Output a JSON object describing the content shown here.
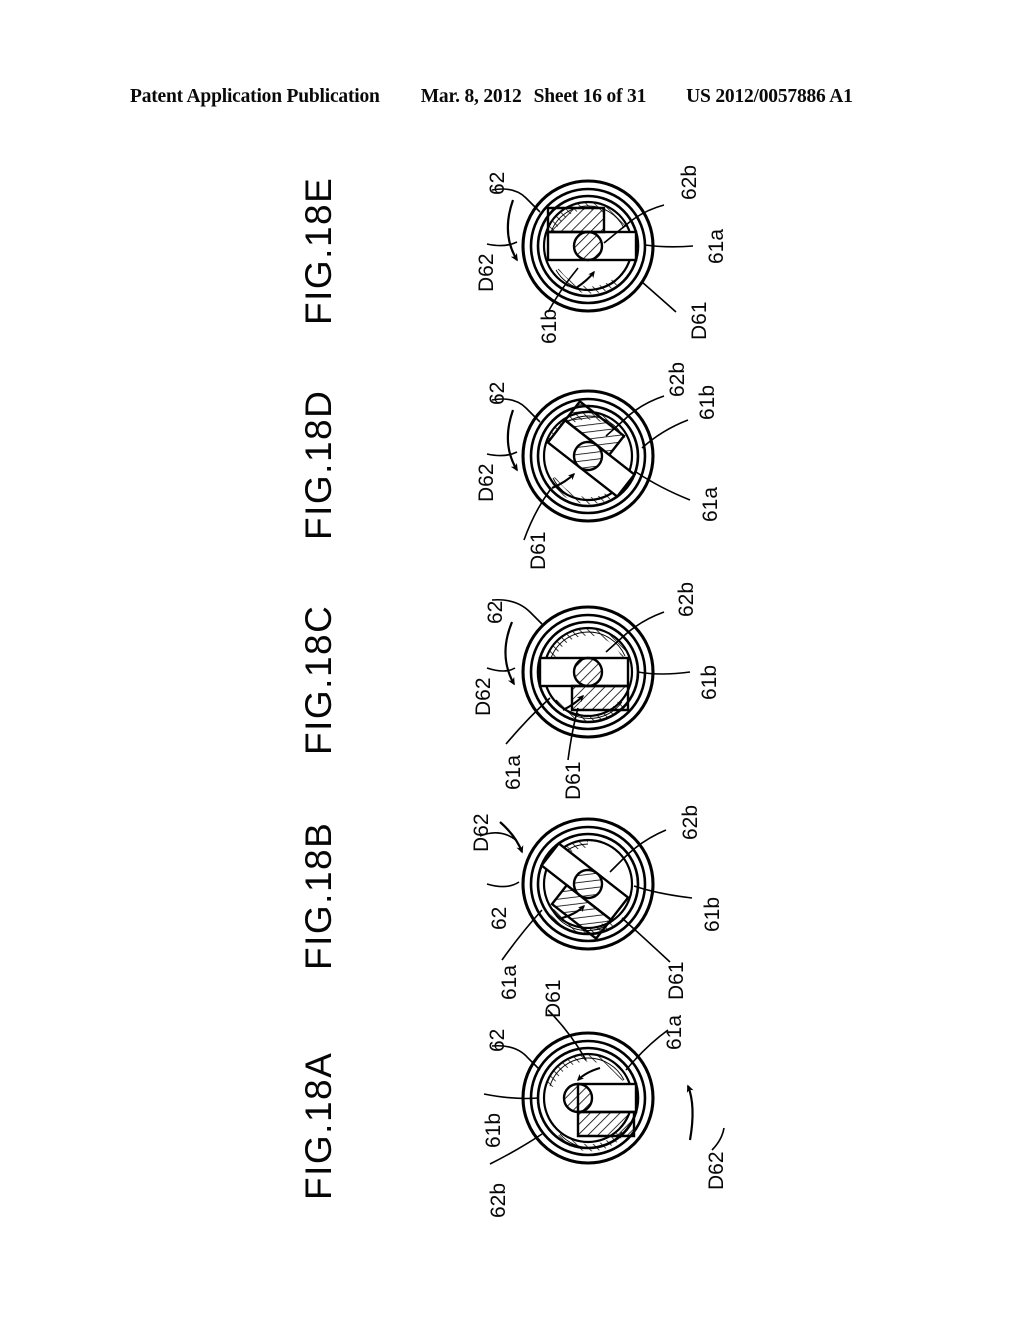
{
  "header": {
    "publication": "Patent Application Publication",
    "date": "Mar. 8, 2012",
    "sheet": "Sheet 16 of 31",
    "pub_number": "US 2012/0057886 A1"
  },
  "figures": [
    {
      "id": "fig-18e",
      "label": "FIG.18E",
      "arm_angle_deg": 0,
      "refs": {
        "outer_ring": "62",
        "inner_arc": "62b",
        "shaft": "61b",
        "arm": "61a",
        "arm_direction": "D61",
        "ring_direction": "D62"
      }
    },
    {
      "id": "fig-18d",
      "label": "FIG.18D",
      "arm_angle_deg": 38,
      "refs": {
        "outer_ring": "62",
        "inner_arc": "62b",
        "shaft": "61b",
        "arm": "61a",
        "arm_direction": "D61",
        "ring_direction": "D62"
      }
    },
    {
      "id": "fig-18c",
      "label": "FIG.18C",
      "arm_angle_deg": 180,
      "refs": {
        "outer_ring": "62",
        "inner_arc": "62b",
        "shaft": "61b",
        "arm": "61a",
        "arm_direction": "D61",
        "ring_direction": "D62"
      }
    },
    {
      "id": "fig-18b",
      "label": "FIG.18B",
      "arm_angle_deg": 218,
      "refs": {
        "outer_ring": "62",
        "inner_arc": "62b",
        "shaft": "61b",
        "arm": "61a",
        "arm_direction": "D61",
        "ring_direction": "D62"
      }
    },
    {
      "id": "fig-18a",
      "label": "FIG.18A",
      "arm_angle_deg": 0,
      "refs": {
        "outer_ring": "62",
        "inner_arc": "62b",
        "shaft": "61b",
        "arm": "61a",
        "arm_direction": "D61",
        "ring_direction": "D62"
      }
    }
  ],
  "colors": {
    "ink": "#000000",
    "paper": "#ffffff"
  }
}
